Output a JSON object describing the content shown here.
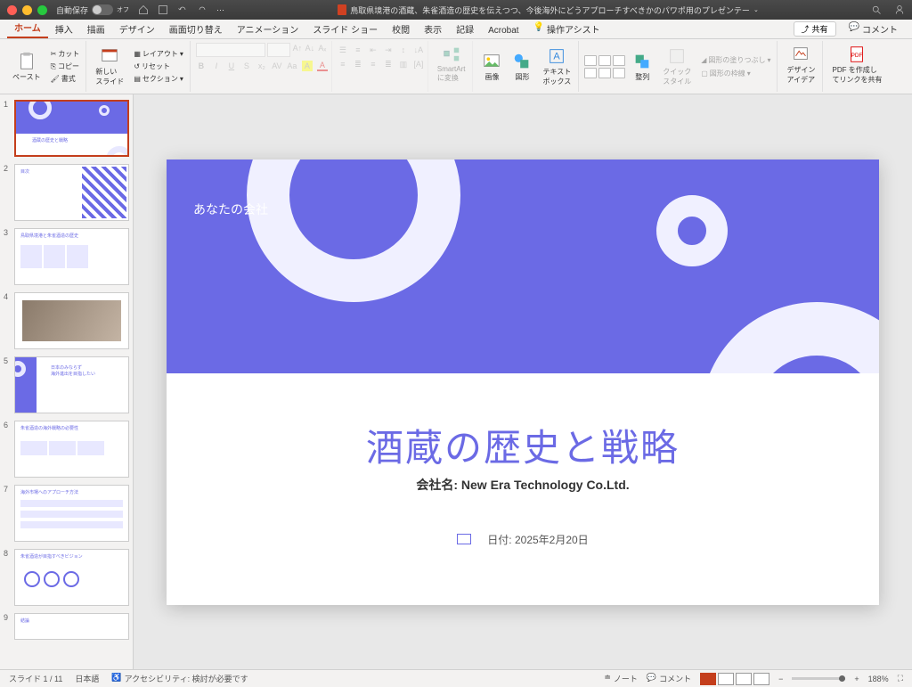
{
  "titlebar": {
    "autosave_label": "自動保存",
    "autosave_state": "オフ",
    "document_title": "鳥取県境港の酒蔵、朱雀酒造の歴史を伝えつつ、今後海外にどうアプローチすべきかのパワポ用のプレゼンテー"
  },
  "tabs": {
    "items": [
      "ホーム",
      "挿入",
      "描画",
      "デザイン",
      "画面切り替え",
      "アニメーション",
      "スライド ショー",
      "校閲",
      "表示",
      "記録",
      "Acrobat"
    ],
    "tell_me": "操作アシスト",
    "share": "共有",
    "comments": "コメント"
  },
  "ribbon": {
    "paste": "ペースト",
    "cut": "カット",
    "copy": "コピー",
    "format_painter": "書式",
    "clipboard_label": "",
    "new_slide": "新しい\nスライド",
    "layout": "レイアウト",
    "reset": "リセット",
    "section": "セクション",
    "font_btns": [
      "B",
      "I",
      "U",
      "S",
      "ab",
      "AV",
      "Aa",
      "A"
    ],
    "smartart": "SmartArt\nに変換",
    "picture": "画像",
    "shapes": "図形",
    "textbox": "テキスト\nボックス",
    "arrange": "整列",
    "quickstyle": "クイック\nスタイル",
    "shape_fill": "図形の塗りつぶし",
    "shape_outline": "図形の枠線",
    "design_ideas": "デザイン\nアイデア",
    "adobe_pdf": "PDF を作成し\nてリンクを共有"
  },
  "thumbs": [
    {
      "num": "1",
      "title": "酒蔵の歴史と戦略"
    },
    {
      "num": "2",
      "title": "目次"
    },
    {
      "num": "3",
      "title": "鳥取県境港と朱雀酒造の歴史"
    },
    {
      "num": "4",
      "title": ""
    },
    {
      "num": "5",
      "title": "日本のみならず\n海外進出を目指したい"
    },
    {
      "num": "6",
      "title": "朱雀酒造の海外戦略の必要性"
    },
    {
      "num": "7",
      "title": "海外市場へのアプローチ方法"
    },
    {
      "num": "8",
      "title": "朱雀酒造が目指すべきビジョン"
    },
    {
      "num": "9",
      "title": "結論"
    }
  ],
  "slide": {
    "company": "あなたの会社",
    "title": "酒蔵の歴史と戦略",
    "subtitle_prefix": "会社名: ",
    "subtitle_name": "New Era Technology Co.Ltd.",
    "date_label": "日付: 2025年2月20日"
  },
  "status": {
    "slide_count": "スライド 1 / 11",
    "language": "日本語",
    "accessibility": "アクセシビリティ: 検討が必要です",
    "notes": "ノート",
    "comments_btn": "コメント",
    "zoom": "188%"
  }
}
